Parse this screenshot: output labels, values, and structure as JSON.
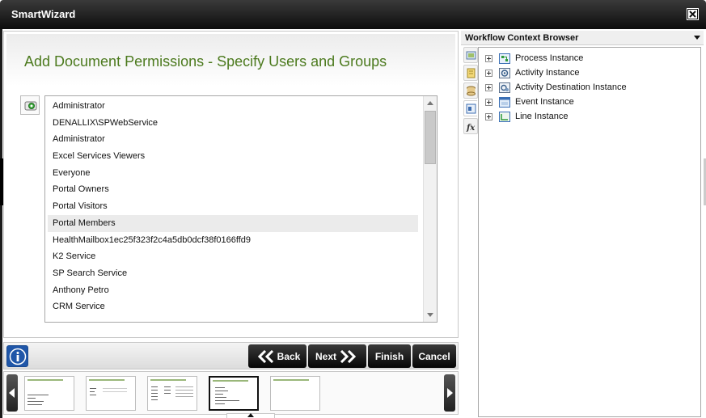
{
  "window": {
    "title": "SmartWizard"
  },
  "wizard": {
    "heading": "Add Document Permissions - Specify Users and Groups",
    "list_items": [
      "Administrator",
      "DENALLIX\\SPWebService",
      "Administrator",
      "Excel Services Viewers",
      "Everyone",
      "Portal Owners",
      "Portal Visitors",
      "Portal Members",
      "HealthMailbox1ec25f323f2c4a5db0dcf38f0166ffd9",
      "K2 Service",
      "SP Search Service",
      "Anthony Petro",
      "CRM Service"
    ],
    "selected_item": "Portal Members"
  },
  "buttons": {
    "back": "Back",
    "next": "Next",
    "finish": "Finish",
    "cancel": "Cancel"
  },
  "context_browser": {
    "title": "Workflow Context Browser",
    "tree": [
      {
        "label": "Process Instance",
        "icon": "process-instance-icon"
      },
      {
        "label": "Activity Instance",
        "icon": "activity-instance-icon"
      },
      {
        "label": "Activity Destination Instance",
        "icon": "activity-destination-icon"
      },
      {
        "label": "Event Instance",
        "icon": "event-instance-icon"
      },
      {
        "label": "Line Instance",
        "icon": "line-instance-icon"
      }
    ]
  },
  "colors": {
    "heading_green": "#4c7a1e",
    "button_black": "#111111",
    "info_blue": "#1f56a8"
  },
  "thumbnails": {
    "count": 5,
    "active_index": 3
  }
}
